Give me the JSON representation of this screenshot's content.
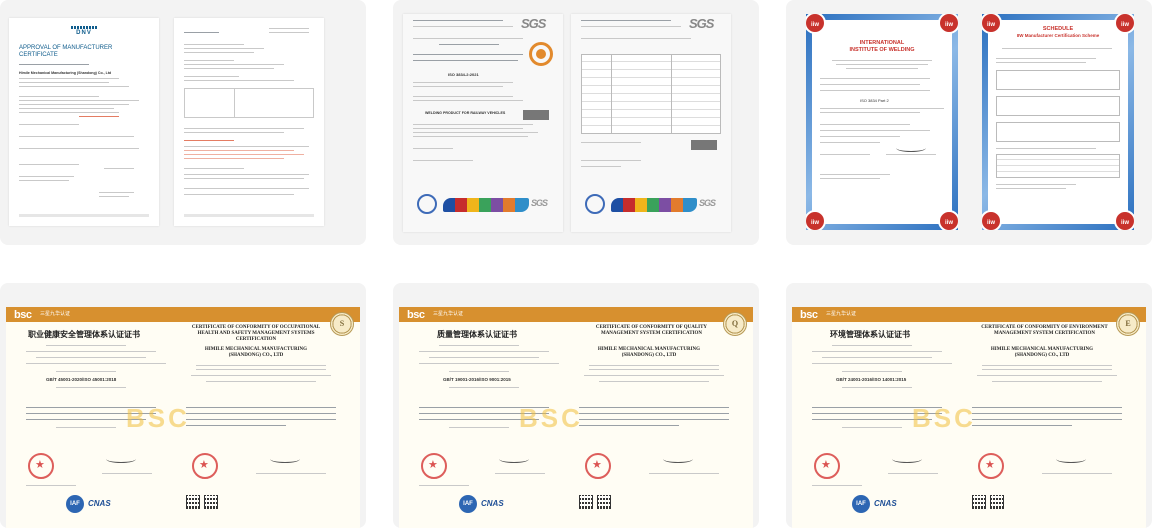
{
  "gallery": {
    "certificates": [
      {
        "id": "dnv",
        "issuer_logo": "DNV",
        "title_line1": "APPROVAL OF MANUFACTURER",
        "title_line2": "CERTIFICATE",
        "holder": "Himile Mechanical Manufacturing (Shandong) Co., Ltd"
      },
      {
        "id": "sgs",
        "issuer_logo": "SGS",
        "standard": "ISO 3834-2:2021",
        "scope": "WELDING PRODUCT FOR RAILWAY VEHICLES",
        "holder": "HIMILE MECHANICAL MANUFACTURING (SHANDONG) CO., LTD"
      },
      {
        "id": "iiw",
        "issuer_logo": "iiw",
        "title_line1": "INTERNATIONAL",
        "title_line2": "INSTITUTE OF WELDING",
        "schedule_title": "SCHEDULE",
        "schedule_subtitle": "IIW Manufacturer Certification Scheme",
        "standard": "ISO 3834 Part 2"
      },
      {
        "id": "ohsms",
        "issuer_logo": "bsc",
        "header_sub": "三星九华认证",
        "emblem_letter": "S",
        "title_cn": "职业健康安全管理体系认证证书",
        "title_en": "CERTIFICATE OF CONFORMITY OF OCCUPATIONAL HEALTH AND SAFETY MANAGEMENT SYSTEMS CERTIFICATION",
        "holder_en": "HIMILE MECHANICAL MANUFACTURING (SHANDONG) CO., LTD",
        "standard": "GB/T 45001-2020/ISO 45001:2018"
      },
      {
        "id": "qms",
        "issuer_logo": "bsc",
        "header_sub": "三星九华认证",
        "emblem_letter": "Q",
        "title_cn": "质量管理体系认证证书",
        "title_en": "CERTIFICATE OF CONFORMITY OF QUALITY MANAGEMENT SYSTEM CERTIFICATION",
        "holder_en": "HIMILE MECHANICAL MANUFACTURING (SHANDONG) CO., LTD",
        "standard": "GB/T 19001-2016/ISO 9001:2015"
      },
      {
        "id": "ems",
        "issuer_logo": "bsc",
        "header_sub": "三星九华认证",
        "emblem_letter": "E",
        "title_cn": "环境管理体系认证证书",
        "title_en": "CERTIFICATE OF CONFORMITY OF ENVIRONMENT MANAGEMENT SYSTEM CERTIFICATION",
        "holder_en": "HIMILE MECHANICAL MANUFACTURING (SHANDONG) CO., LTD",
        "standard": "GB/T 24001-2016/ISO 14001:2015"
      }
    ],
    "badges": {
      "iaf": "IAF",
      "cnas": "CNAS"
    },
    "colors": {
      "card_bg": "#f3f3f3",
      "bsc_orange": "#d7902f",
      "iiw_red": "#c8322c",
      "dnv_blue": "#0f5c8c"
    }
  }
}
